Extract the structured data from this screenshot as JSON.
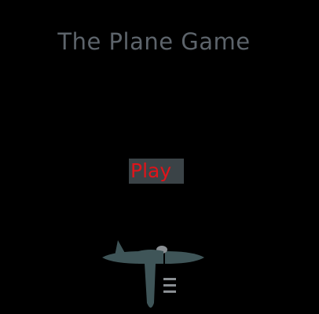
{
  "game": {
    "title": "The Plane Game",
    "play_label": "Play",
    "colors": {
      "background": "#000000",
      "title": "#5d646b",
      "play_text": "#e0141a",
      "play_bg": "#3b4347",
      "plane": "#3f5558",
      "plane_accent": "#8a8f93"
    },
    "player_icon": "plane-icon"
  }
}
